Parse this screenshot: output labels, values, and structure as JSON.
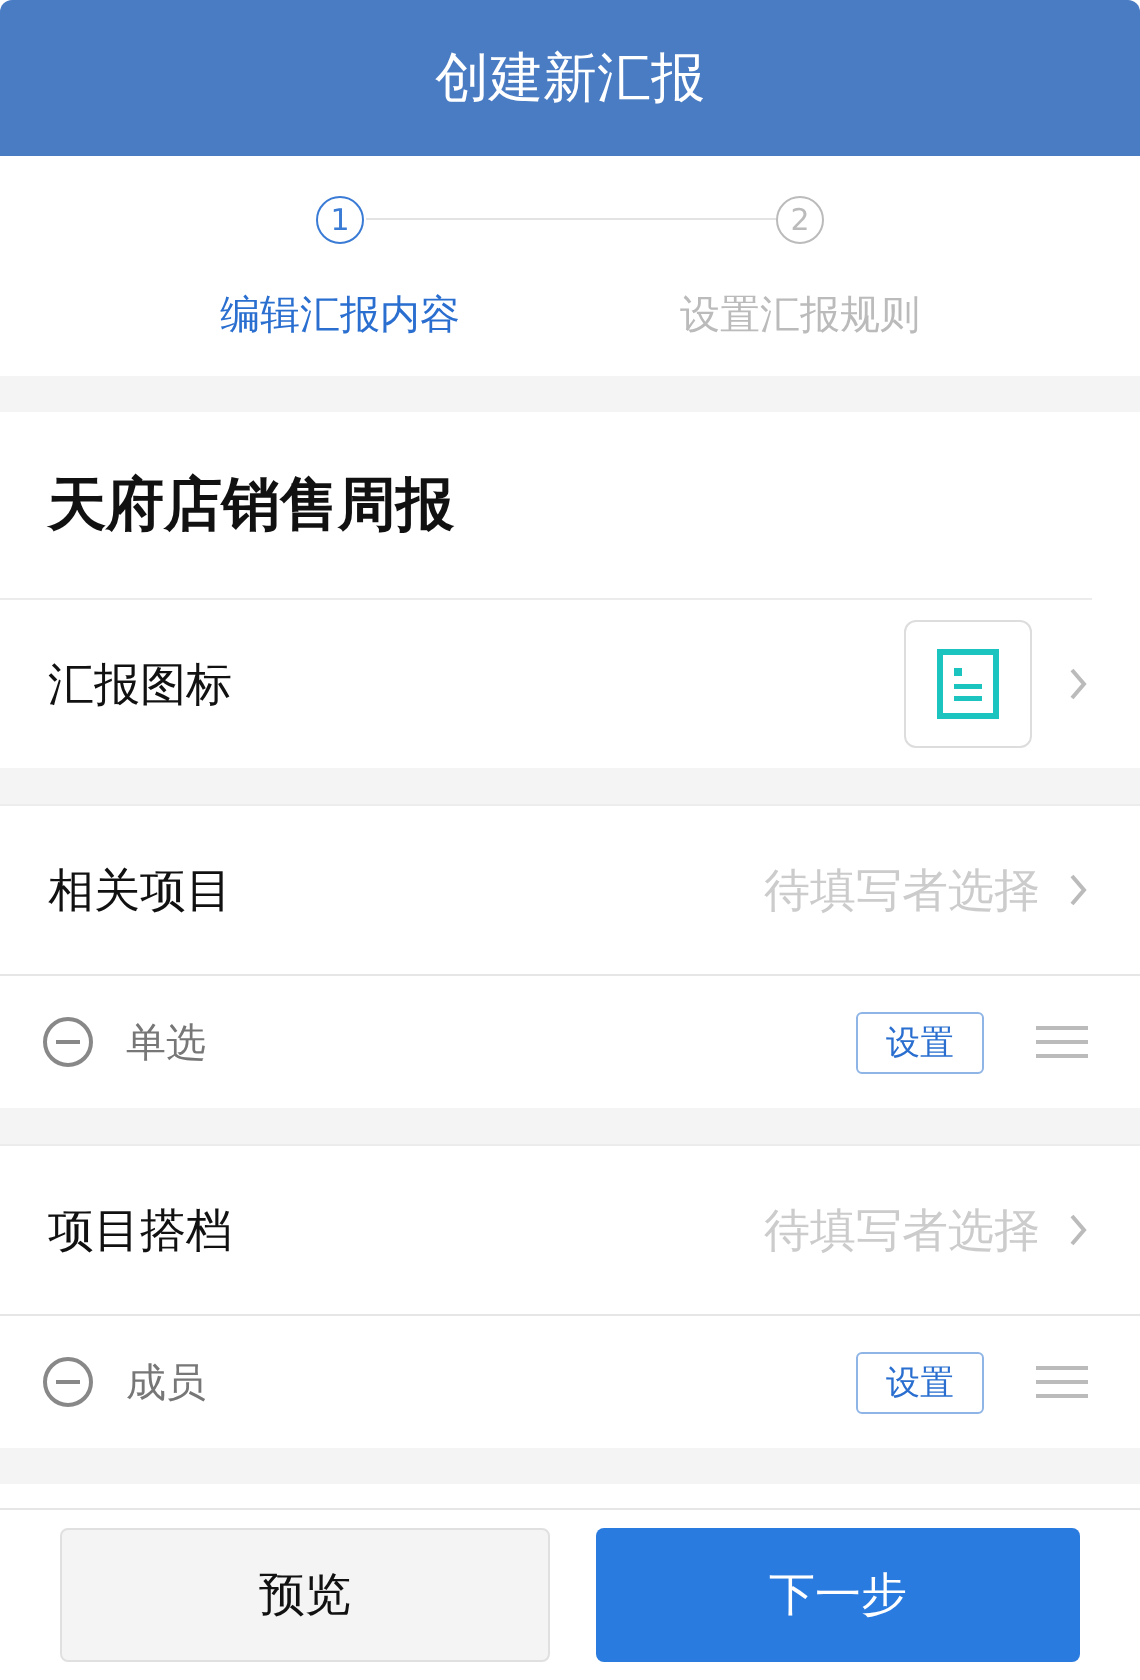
{
  "header": {
    "title": "创建新汇报"
  },
  "steps": [
    {
      "number": "1",
      "label": "编辑汇报内容",
      "selected": true
    },
    {
      "number": "2",
      "label": "设置汇报规则",
      "selected": false
    }
  ],
  "report_title": "天府店销售周报",
  "icon_row": {
    "label": "汇报图标"
  },
  "fields": [
    {
      "label": "相关项目",
      "placeholder": "待填写者选择",
      "option": {
        "label": "单选",
        "button": "设置"
      }
    },
    {
      "label": "项目搭档",
      "placeholder": "待填写者选择",
      "option": {
        "label": "成员",
        "button": "设置"
      }
    }
  ],
  "footer": {
    "buttons": [
      {
        "label": "预览",
        "kind": "secondary"
      },
      {
        "label": "下一步",
        "kind": "primary"
      }
    ]
  }
}
